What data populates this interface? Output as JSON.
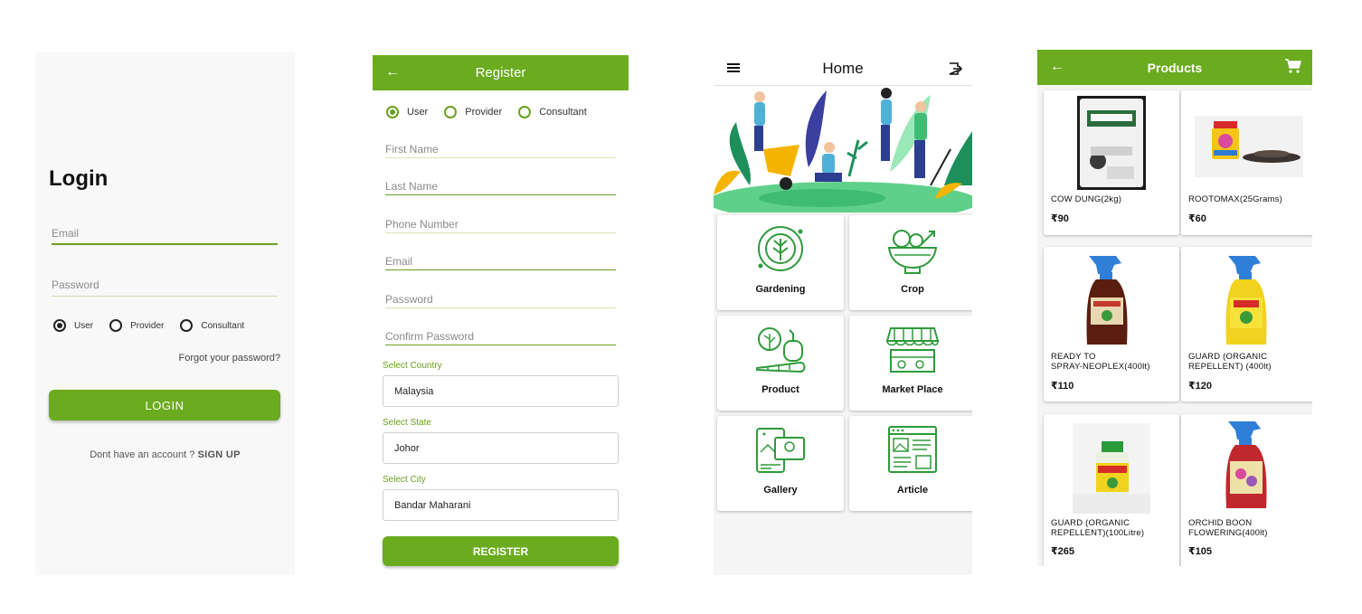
{
  "login": {
    "title": "Login",
    "email_placeholder": "Email",
    "password_placeholder": "Password",
    "roles": [
      "User",
      "Provider",
      "Consultant"
    ],
    "selected_role": "User",
    "forgot_password": "Forgot your password?",
    "login_button": "LOGIN",
    "signup_prompt": "Dont have an account ?",
    "signup_link": "SIGN UP"
  },
  "register": {
    "title": "Register",
    "back_icon": "arrow-left-icon",
    "roles": [
      "User",
      "Provider",
      "Consultant"
    ],
    "selected_role": "User",
    "fields": {
      "first_name": "First Name",
      "last_name": "Last Name",
      "phone": "Phone Number",
      "email": "Email",
      "password": "Password",
      "confirm_password": "Confirm Password"
    },
    "country_label": "Select Country",
    "country_value": "Malaysia",
    "state_label": "Select State",
    "state_value": "Johor",
    "city_label": "Select City",
    "city_value": "Bandar Maharani",
    "register_button": "REGISTER"
  },
  "home": {
    "title": "Home",
    "menu_icon": "hamburger-menu-icon",
    "logout_icon": "exit-icon",
    "tiles": [
      {
        "label": "Gardening",
        "icon": "leaf-circle-icon"
      },
      {
        "label": "Crop",
        "icon": "vegetable-bowl-icon"
      },
      {
        "label": "Product",
        "icon": "vegetables-icon"
      },
      {
        "label": "Market Place",
        "icon": "market-stall-icon"
      },
      {
        "label": "Gallery",
        "icon": "gallery-tablet-icon"
      },
      {
        "label": "Article",
        "icon": "article-page-icon"
      }
    ]
  },
  "products": {
    "title": "Products",
    "back_icon": "arrow-left-icon",
    "cart_icon": "cart-icon",
    "items": [
      {
        "name": "COW DUNG(2kg)",
        "price": "₹90"
      },
      {
        "name": "ROOTOMAX(25Grams)",
        "price": "₹60"
      },
      {
        "name": "READY TO SPRAY-NEOPLEX(400lt)",
        "name_lines": [
          "READY TO",
          "SPRAY-NEOPLEX(400lt)"
        ],
        "price": "₹110"
      },
      {
        "name": "GUARD (ORGANIC REPELLENT) (400lt)",
        "name_lines": [
          "GUARD (ORGANIC",
          "REPELLENT) (400lt)"
        ],
        "price": "₹120"
      },
      {
        "name": "GUARD (ORGANIC REPELLENT)(100Litre)",
        "name_lines": [
          "GUARD (ORGANIC",
          "REPELLENT)(100Litre)"
        ],
        "price": "₹265"
      },
      {
        "name": "ORCHID BOON FLOWERING(400lt)",
        "name_lines": [
          "ORCHID BOON",
          "FLOWERING(400lt)"
        ],
        "price": "₹105"
      }
    ]
  },
  "colors": {
    "brand_green": "#6aab1f",
    "icon_green": "#2e9a3a"
  }
}
